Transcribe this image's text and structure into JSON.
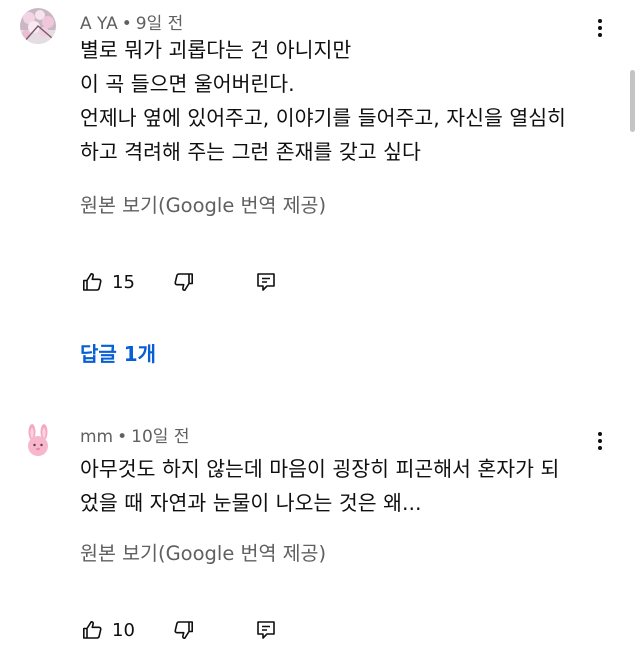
{
  "comments": [
    {
      "author": "A YA",
      "time": "9일 전",
      "lines": [
        "별로 뭐가 괴롭다는 건 아니지만",
        "이 곡 들으면 울어버린다.",
        "언제나 옆에 있어주고, 이야기를 들어주고, 자신을 열심히",
        "하고 격려해 주는 그런 존재를 갖고 싶다"
      ],
      "translate_label": "원본 보기(Google 번역 제공)",
      "likes": "15",
      "replies_label": "답글 1개",
      "avatar_icon": "cherry-blossom-avatar"
    },
    {
      "author": "mm",
      "time": "10일 전",
      "lines": [
        "아무것도 하지 않는데 마음이 굉장히 피곤해서 혼자가 되",
        "었을 때 자연과 눈물이 나오는 것은 왜..."
      ],
      "translate_label": "원본 보기(Google 번역 제공)",
      "likes": "10",
      "avatar_icon": "pink-bunny-avatar"
    }
  ],
  "meta_separator": "•",
  "colors": {
    "text_primary": "#0f0f0f",
    "text_secondary": "#606060",
    "link_blue": "#065fd4"
  },
  "icons": [
    "thumbs-up-icon",
    "thumbs-down-icon",
    "reply-icon",
    "more-vert-icon"
  ]
}
